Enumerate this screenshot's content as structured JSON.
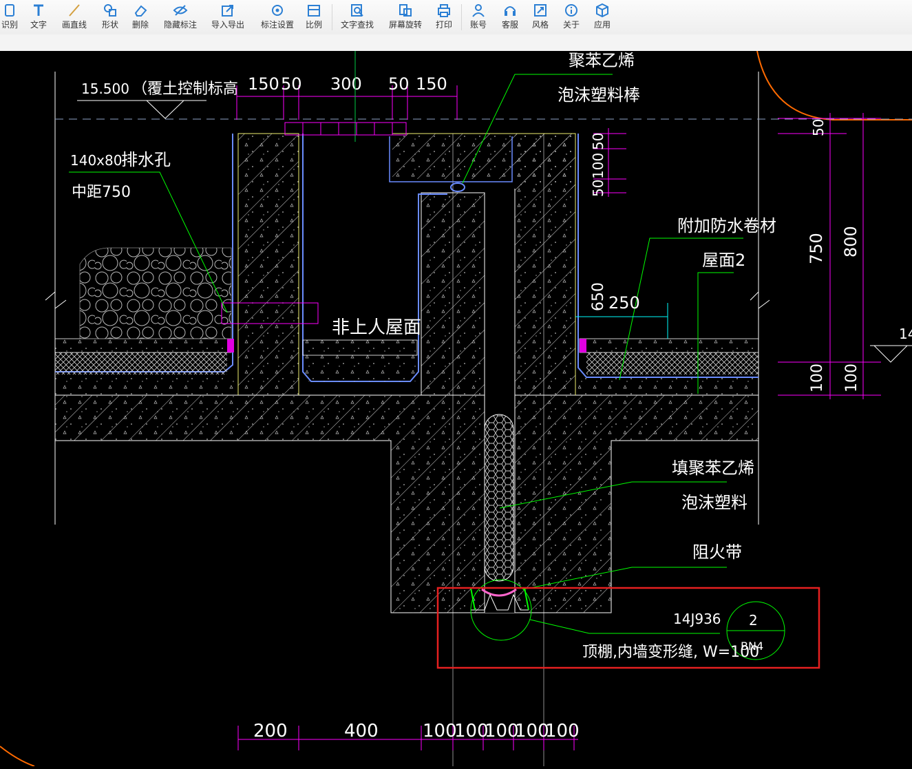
{
  "toolbar": {
    "items": [
      {
        "label": "识别",
        "icon": "recognize-icon"
      },
      {
        "label": "文字",
        "icon": "text-icon"
      },
      {
        "label": "画直线",
        "icon": "line-icon"
      },
      {
        "label": "形状",
        "icon": "shape-icon"
      },
      {
        "label": "删除",
        "icon": "eraser-icon"
      },
      {
        "label": "隐藏标注",
        "icon": "hide-eye-icon"
      },
      {
        "label": "导入导出",
        "icon": "import-export-icon"
      },
      {
        "label": "标注设置",
        "icon": "annotation-settings-icon"
      },
      {
        "label": "比例",
        "icon": "scale-icon"
      },
      {
        "label": "文字查找",
        "icon": "text-search-icon"
      },
      {
        "label": "屏幕旋转",
        "icon": "rotate-screen-icon"
      },
      {
        "label": "打印",
        "icon": "printer-icon"
      },
      {
        "label": "账号",
        "icon": "user-icon"
      },
      {
        "label": "客服",
        "icon": "headset-icon"
      },
      {
        "label": "风格",
        "icon": "style-icon"
      },
      {
        "label": "关于",
        "icon": "info-icon"
      },
      {
        "label": "应用",
        "icon": "cube-icon"
      }
    ],
    "accent": "#2b7fd4"
  },
  "drawing": {
    "colors": {
      "background": "#000000",
      "structure": "#ffffff",
      "leader": "#00ff00",
      "dimension": "#ff00ff",
      "highlight": "#e62020",
      "waterproof": "#6a8cff",
      "axis": "#808080"
    },
    "elevation_value": "15.500",
    "elevation_note": "（覆土控制标高",
    "top_dims": [
      "150",
      "50",
      "300",
      "50",
      "150"
    ],
    "label_foam_rod_1": "聚苯乙烯",
    "label_foam_rod_2": "泡沫塑料棒",
    "drain_size": "140x80",
    "drain_label": "排水孔",
    "drain_spacing": "中距750",
    "roof_label": "非上人屋面",
    "waterproof_label": "附加防水卷材",
    "roof2_label": "屋面2",
    "dim_650": "650",
    "dim_250": "250",
    "right_stack_dims": [
      "50",
      "100",
      "50"
    ],
    "dim_750": "750",
    "dim_800": "800",
    "dim_100a": "100",
    "dim_100b": "100",
    "dim_right_edge": "14",
    "filler_label_1": "填聚苯乙烯",
    "filler_label_2": "泡沫塑料",
    "fire_label": "阻火带",
    "ref_code": "14J936",
    "ref_number": "2",
    "ref_detail": "BN4",
    "ref_desc": "顶棚,内墙变形缝, W=100",
    "bottom_dims": [
      "200",
      "400",
      "100",
      "100",
      "100",
      "100",
      "100"
    ]
  }
}
